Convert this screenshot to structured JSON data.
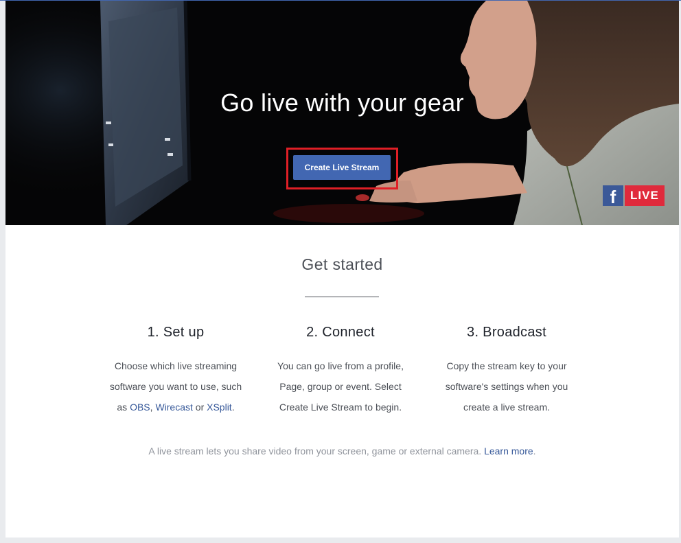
{
  "hero": {
    "title": "Go live with your gear",
    "create_button_label": "Create Live Stream",
    "badge": {
      "logo_glyph": "f",
      "live_label": "LIVE",
      "icon": "facebook-icon"
    }
  },
  "get_started": {
    "heading": "Get started",
    "steps": [
      {
        "title": "1. Set up",
        "line1": "Choose which live streaming",
        "line2": "software you want to use, such",
        "line3_pre": "as ",
        "link_obs": "OBS",
        "sep1": ", ",
        "link_wirecast": "Wirecast",
        "sep2": " or ",
        "link_xsplit": "XSplit",
        "line3_post": "."
      },
      {
        "title": "2. Connect",
        "line1": "You can go live from a profile,",
        "line2": "Page, group or event. Select",
        "line3": "Create Live Stream to begin."
      },
      {
        "title": "3. Broadcast",
        "line1": "Copy the stream key to your",
        "line2": "software's settings when you",
        "line3": "create a live stream."
      }
    ]
  },
  "footnote": {
    "text": "A live stream lets you share video from your screen, game or external camera. ",
    "link": "Learn more",
    "end": "."
  },
  "colors": {
    "brand_blue": "#4267b2",
    "highlight_red": "#e01f26",
    "live_red": "#e02a3c",
    "link_blue": "#365899"
  }
}
